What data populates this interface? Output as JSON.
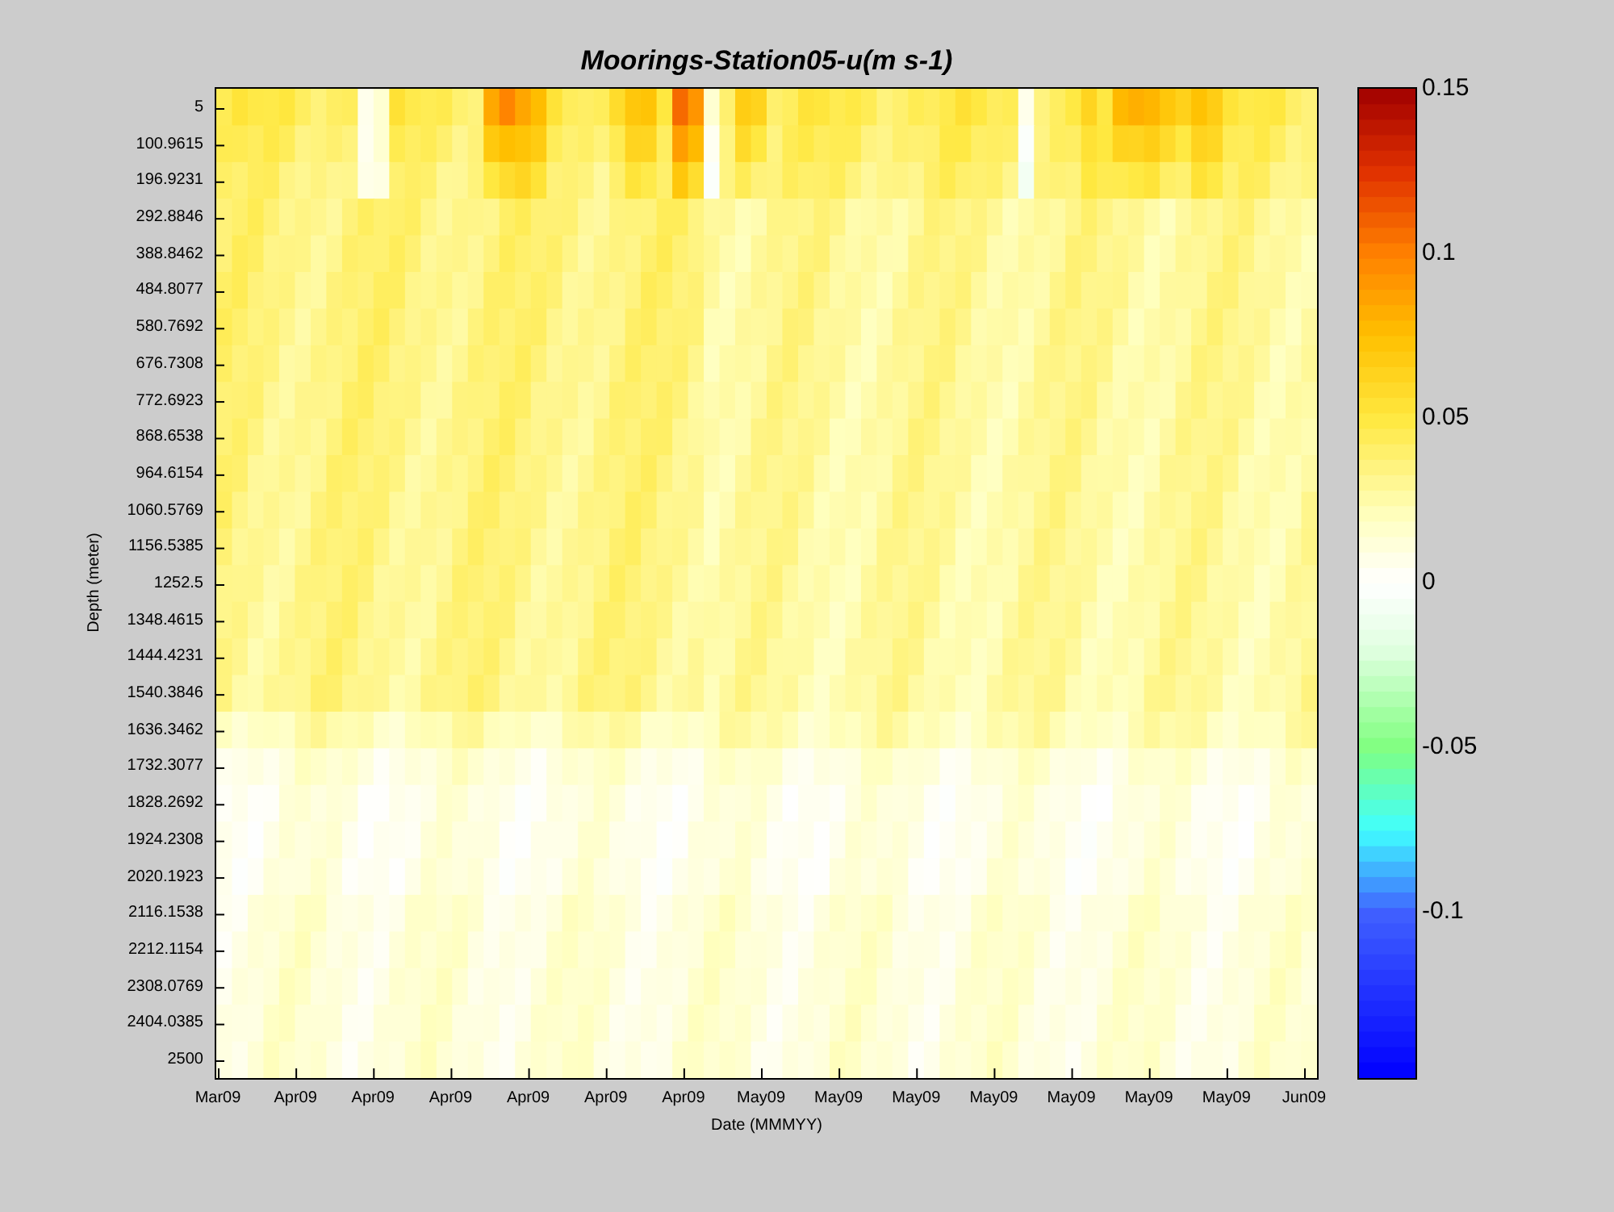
{
  "title": "Moorings-Station05-u(m s-1)",
  "ylabel": "Depth (meter)",
  "xlabel": "Date (MMMYY)",
  "yticks": [
    "5",
    "100.9615",
    "196.9231",
    "292.8846",
    "388.8462",
    "484.8077",
    "580.7692",
    "676.7308",
    "772.6923",
    "868.6538",
    "964.6154",
    "1060.5769",
    "1156.5385",
    "1252.5",
    "1348.4615",
    "1444.4231",
    "1540.3846",
    "1636.3462",
    "1732.3077",
    "1828.2692",
    "1924.2308",
    "2020.1923",
    "2116.1538",
    "2212.1154",
    "2308.0769",
    "2404.0385",
    "2500"
  ],
  "xticks": [
    "Mar09",
    "Apr09",
    "Apr09",
    "Apr09",
    "Apr09",
    "Apr09",
    "Apr09",
    "May09",
    "May09",
    "May09",
    "May09",
    "May09",
    "May09",
    "May09",
    "Jun09"
  ],
  "colorbar_ticks": [
    "0.15",
    "0.1",
    "0.05",
    "0",
    "-0.05",
    "-0.1"
  ]
}
